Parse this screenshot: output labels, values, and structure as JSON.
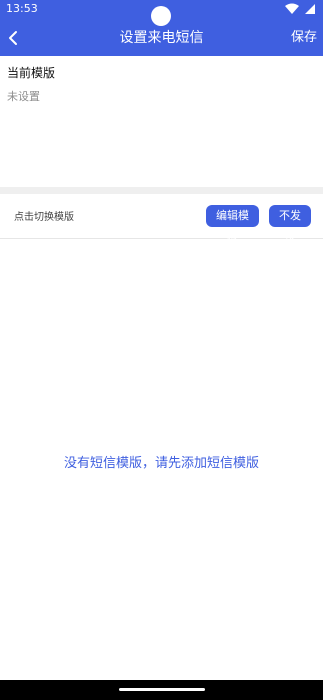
{
  "statusbar": {
    "time": "13:53",
    "icons": [
      "wifi-icon",
      "signal-icon",
      "camera-hole-icon"
    ]
  },
  "header": {
    "back_icon": "back-chevron-icon",
    "title": "设置来电短信",
    "save_label": "保存"
  },
  "current_template": {
    "label": "当前模版",
    "value": "未设置"
  },
  "switch_row": {
    "hint": "点击切换模版",
    "edit_button": "编辑模板",
    "no_send_button": "不发送"
  },
  "empty_state": {
    "message": "没有短信模版，请先添加短信模版"
  },
  "colors": {
    "primary": "#3f5fe0",
    "background": "#ffffff",
    "band": "#efefef",
    "nav_bar": "#000000"
  }
}
